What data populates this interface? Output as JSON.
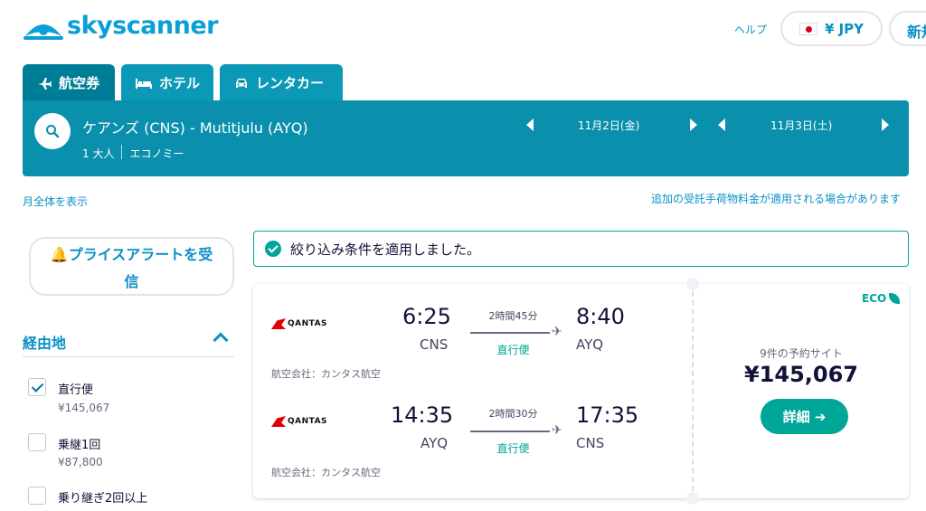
{
  "header": {
    "logo_text": "skyscanner",
    "help_label": "ヘルプ",
    "currency_label": "¥ JPY",
    "signup_label": "新規"
  },
  "tabs": [
    {
      "label": "航空券",
      "icon": "plane-icon",
      "active": true
    },
    {
      "label": "ホテル",
      "icon": "bed-icon",
      "active": false
    },
    {
      "label": "レンタカー",
      "icon": "car-icon",
      "active": false
    }
  ],
  "search": {
    "route": "ケアンズ (CNS) - Mutitjulu (AYQ)",
    "passengers": "1 大人",
    "cabin": "エコノミー",
    "depart_date": "11月2日(金)",
    "return_date": "11月3日(土)"
  },
  "links": {
    "month_view": "月全体を表示",
    "baggage_note": "追加の受託手荷物料金が適用される場合があります"
  },
  "sidebar": {
    "price_alert_line1": "🔔プライスアラートを受",
    "price_alert_line2": "信",
    "stops_title": "経由地",
    "stop_options": [
      {
        "label": "直行便",
        "price": "¥145,067",
        "checked": true
      },
      {
        "label": "乗継1回",
        "price": "¥87,800",
        "checked": false
      },
      {
        "label": "乗り継ぎ2回以上",
        "price": "",
        "checked": false
      }
    ]
  },
  "filter_banner": "絞り込み条件を適用しました。",
  "result": {
    "eco_label": "ECO",
    "legs": [
      {
        "airline": "QANTAS",
        "depart_time": "6:25",
        "depart_code": "CNS",
        "duration": "2時間45分",
        "stops": "直行便",
        "arrive_time": "8:40",
        "arrive_code": "AYQ",
        "carrier": "航空会社：カンタス航空"
      },
      {
        "airline": "QANTAS",
        "depart_time": "14:35",
        "depart_code": "AYQ",
        "duration": "2時間30分",
        "stops": "直行便",
        "arrive_time": "17:35",
        "arrive_code": "CNS",
        "carrier": "航空会社：カンタス航空"
      }
    ],
    "sites_label": "9件の予約サイト",
    "price": "¥145,067",
    "detail_label": "詳細 ➔"
  },
  "colors": {
    "brand": "#0a9fd6",
    "search_bar": "#0a8fad",
    "accent_green": "#00a698"
  }
}
